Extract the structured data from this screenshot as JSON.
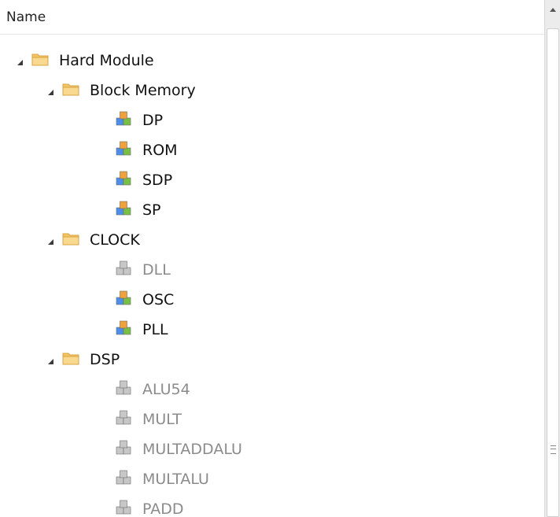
{
  "header": {
    "name_label": "Name"
  },
  "tree": [
    {
      "label": "Hard Module",
      "icon": "folder-icon",
      "level": 0,
      "expanded": true,
      "enabled": true
    },
    {
      "label": "Block Memory",
      "icon": "folder-icon",
      "level": 1,
      "expanded": true,
      "enabled": true
    },
    {
      "label": "DP",
      "icon": "module-cubes-icon",
      "level": 2,
      "enabled": true
    },
    {
      "label": "ROM",
      "icon": "module-cubes-icon",
      "level": 2,
      "enabled": true
    },
    {
      "label": "SDP",
      "icon": "module-cubes-icon",
      "level": 2,
      "enabled": true
    },
    {
      "label": "SP",
      "icon": "module-cubes-icon",
      "level": 2,
      "enabled": true
    },
    {
      "label": "CLOCK",
      "icon": "folder-icon",
      "level": 1,
      "expanded": true,
      "enabled": true
    },
    {
      "label": "DLL",
      "icon": "module-cubes-icon",
      "level": 2,
      "enabled": false
    },
    {
      "label": "OSC",
      "icon": "module-cubes-icon",
      "level": 2,
      "enabled": true
    },
    {
      "label": "PLL",
      "icon": "module-cubes-icon",
      "level": 2,
      "enabled": true
    },
    {
      "label": "DSP",
      "icon": "folder-icon",
      "level": 1,
      "expanded": true,
      "enabled": true
    },
    {
      "label": "ALU54",
      "icon": "module-cubes-icon",
      "level": 2,
      "enabled": false
    },
    {
      "label": "MULT",
      "icon": "module-cubes-icon",
      "level": 2,
      "enabled": false
    },
    {
      "label": "MULTADDALU",
      "icon": "module-cubes-icon",
      "level": 2,
      "enabled": false
    },
    {
      "label": "MULTALU",
      "icon": "module-cubes-icon",
      "level": 2,
      "enabled": false
    },
    {
      "label": "PADD",
      "icon": "module-cubes-icon",
      "level": 2,
      "enabled": false
    }
  ],
  "colors": {
    "folder": "#f3c567",
    "folder_dark": "#d7a441",
    "cube_blue": "#4f8ee8",
    "cube_orange": "#f0a13a",
    "cube_green": "#78c043",
    "cube_disabled": "#c7c7c7"
  }
}
